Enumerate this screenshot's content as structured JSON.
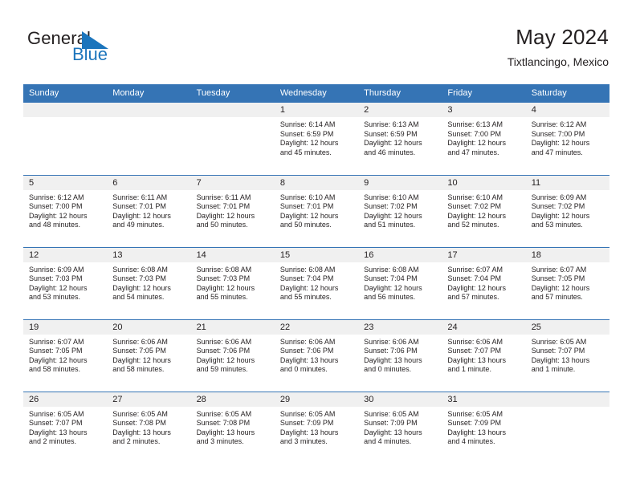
{
  "brand": {
    "name_top": "General",
    "name_bottom": "Blue",
    "triangle_icon": "triangle-icon",
    "color_dark": "#231f20",
    "color_blue": "#1c75bc"
  },
  "header": {
    "title": "May 2024",
    "location": "Tixtlancingo, Mexico"
  },
  "theme": {
    "header_bg": "#3574b5",
    "header_text": "#ffffff",
    "daynum_band_bg": "#f0f0f0",
    "cell_bg": "#ffffff",
    "row_separator": "#3574b5",
    "body_text": "#231f20"
  },
  "weekdays": [
    "Sunday",
    "Monday",
    "Tuesday",
    "Wednesday",
    "Thursday",
    "Friday",
    "Saturday"
  ],
  "weeks": [
    [
      {
        "day": "",
        "empty": true
      },
      {
        "day": "",
        "empty": true
      },
      {
        "day": "",
        "empty": true
      },
      {
        "day": "1",
        "sunrise": "Sunrise: 6:14 AM",
        "sunset": "Sunset: 6:59 PM",
        "daylight_1": "Daylight: 12 hours",
        "daylight_2": "and 45 minutes."
      },
      {
        "day": "2",
        "sunrise": "Sunrise: 6:13 AM",
        "sunset": "Sunset: 6:59 PM",
        "daylight_1": "Daylight: 12 hours",
        "daylight_2": "and 46 minutes."
      },
      {
        "day": "3",
        "sunrise": "Sunrise: 6:13 AM",
        "sunset": "Sunset: 7:00 PM",
        "daylight_1": "Daylight: 12 hours",
        "daylight_2": "and 47 minutes."
      },
      {
        "day": "4",
        "sunrise": "Sunrise: 6:12 AM",
        "sunset": "Sunset: 7:00 PM",
        "daylight_1": "Daylight: 12 hours",
        "daylight_2": "and 47 minutes."
      }
    ],
    [
      {
        "day": "5",
        "sunrise": "Sunrise: 6:12 AM",
        "sunset": "Sunset: 7:00 PM",
        "daylight_1": "Daylight: 12 hours",
        "daylight_2": "and 48 minutes."
      },
      {
        "day": "6",
        "sunrise": "Sunrise: 6:11 AM",
        "sunset": "Sunset: 7:01 PM",
        "daylight_1": "Daylight: 12 hours",
        "daylight_2": "and 49 minutes."
      },
      {
        "day": "7",
        "sunrise": "Sunrise: 6:11 AM",
        "sunset": "Sunset: 7:01 PM",
        "daylight_1": "Daylight: 12 hours",
        "daylight_2": "and 50 minutes."
      },
      {
        "day": "8",
        "sunrise": "Sunrise: 6:10 AM",
        "sunset": "Sunset: 7:01 PM",
        "daylight_1": "Daylight: 12 hours",
        "daylight_2": "and 50 minutes."
      },
      {
        "day": "9",
        "sunrise": "Sunrise: 6:10 AM",
        "sunset": "Sunset: 7:02 PM",
        "daylight_1": "Daylight: 12 hours",
        "daylight_2": "and 51 minutes."
      },
      {
        "day": "10",
        "sunrise": "Sunrise: 6:10 AM",
        "sunset": "Sunset: 7:02 PM",
        "daylight_1": "Daylight: 12 hours",
        "daylight_2": "and 52 minutes."
      },
      {
        "day": "11",
        "sunrise": "Sunrise: 6:09 AM",
        "sunset": "Sunset: 7:02 PM",
        "daylight_1": "Daylight: 12 hours",
        "daylight_2": "and 53 minutes."
      }
    ],
    [
      {
        "day": "12",
        "sunrise": "Sunrise: 6:09 AM",
        "sunset": "Sunset: 7:03 PM",
        "daylight_1": "Daylight: 12 hours",
        "daylight_2": "and 53 minutes."
      },
      {
        "day": "13",
        "sunrise": "Sunrise: 6:08 AM",
        "sunset": "Sunset: 7:03 PM",
        "daylight_1": "Daylight: 12 hours",
        "daylight_2": "and 54 minutes."
      },
      {
        "day": "14",
        "sunrise": "Sunrise: 6:08 AM",
        "sunset": "Sunset: 7:03 PM",
        "daylight_1": "Daylight: 12 hours",
        "daylight_2": "and 55 minutes."
      },
      {
        "day": "15",
        "sunrise": "Sunrise: 6:08 AM",
        "sunset": "Sunset: 7:04 PM",
        "daylight_1": "Daylight: 12 hours",
        "daylight_2": "and 55 minutes."
      },
      {
        "day": "16",
        "sunrise": "Sunrise: 6:08 AM",
        "sunset": "Sunset: 7:04 PM",
        "daylight_1": "Daylight: 12 hours",
        "daylight_2": "and 56 minutes."
      },
      {
        "day": "17",
        "sunrise": "Sunrise: 6:07 AM",
        "sunset": "Sunset: 7:04 PM",
        "daylight_1": "Daylight: 12 hours",
        "daylight_2": "and 57 minutes."
      },
      {
        "day": "18",
        "sunrise": "Sunrise: 6:07 AM",
        "sunset": "Sunset: 7:05 PM",
        "daylight_1": "Daylight: 12 hours",
        "daylight_2": "and 57 minutes."
      }
    ],
    [
      {
        "day": "19",
        "sunrise": "Sunrise: 6:07 AM",
        "sunset": "Sunset: 7:05 PM",
        "daylight_1": "Daylight: 12 hours",
        "daylight_2": "and 58 minutes."
      },
      {
        "day": "20",
        "sunrise": "Sunrise: 6:06 AM",
        "sunset": "Sunset: 7:05 PM",
        "daylight_1": "Daylight: 12 hours",
        "daylight_2": "and 58 minutes."
      },
      {
        "day": "21",
        "sunrise": "Sunrise: 6:06 AM",
        "sunset": "Sunset: 7:06 PM",
        "daylight_1": "Daylight: 12 hours",
        "daylight_2": "and 59 minutes."
      },
      {
        "day": "22",
        "sunrise": "Sunrise: 6:06 AM",
        "sunset": "Sunset: 7:06 PM",
        "daylight_1": "Daylight: 13 hours",
        "daylight_2": "and 0 minutes."
      },
      {
        "day": "23",
        "sunrise": "Sunrise: 6:06 AM",
        "sunset": "Sunset: 7:06 PM",
        "daylight_1": "Daylight: 13 hours",
        "daylight_2": "and 0 minutes."
      },
      {
        "day": "24",
        "sunrise": "Sunrise: 6:06 AM",
        "sunset": "Sunset: 7:07 PM",
        "daylight_1": "Daylight: 13 hours",
        "daylight_2": "and 1 minute."
      },
      {
        "day": "25",
        "sunrise": "Sunrise: 6:05 AM",
        "sunset": "Sunset: 7:07 PM",
        "daylight_1": "Daylight: 13 hours",
        "daylight_2": "and 1 minute."
      }
    ],
    [
      {
        "day": "26",
        "sunrise": "Sunrise: 6:05 AM",
        "sunset": "Sunset: 7:07 PM",
        "daylight_1": "Daylight: 13 hours",
        "daylight_2": "and 2 minutes."
      },
      {
        "day": "27",
        "sunrise": "Sunrise: 6:05 AM",
        "sunset": "Sunset: 7:08 PM",
        "daylight_1": "Daylight: 13 hours",
        "daylight_2": "and 2 minutes."
      },
      {
        "day": "28",
        "sunrise": "Sunrise: 6:05 AM",
        "sunset": "Sunset: 7:08 PM",
        "daylight_1": "Daylight: 13 hours",
        "daylight_2": "and 3 minutes."
      },
      {
        "day": "29",
        "sunrise": "Sunrise: 6:05 AM",
        "sunset": "Sunset: 7:09 PM",
        "daylight_1": "Daylight: 13 hours",
        "daylight_2": "and 3 minutes."
      },
      {
        "day": "30",
        "sunrise": "Sunrise: 6:05 AM",
        "sunset": "Sunset: 7:09 PM",
        "daylight_1": "Daylight: 13 hours",
        "daylight_2": "and 4 minutes."
      },
      {
        "day": "31",
        "sunrise": "Sunrise: 6:05 AM",
        "sunset": "Sunset: 7:09 PM",
        "daylight_1": "Daylight: 13 hours",
        "daylight_2": "and 4 minutes."
      },
      {
        "day": "",
        "empty": true
      }
    ]
  ]
}
